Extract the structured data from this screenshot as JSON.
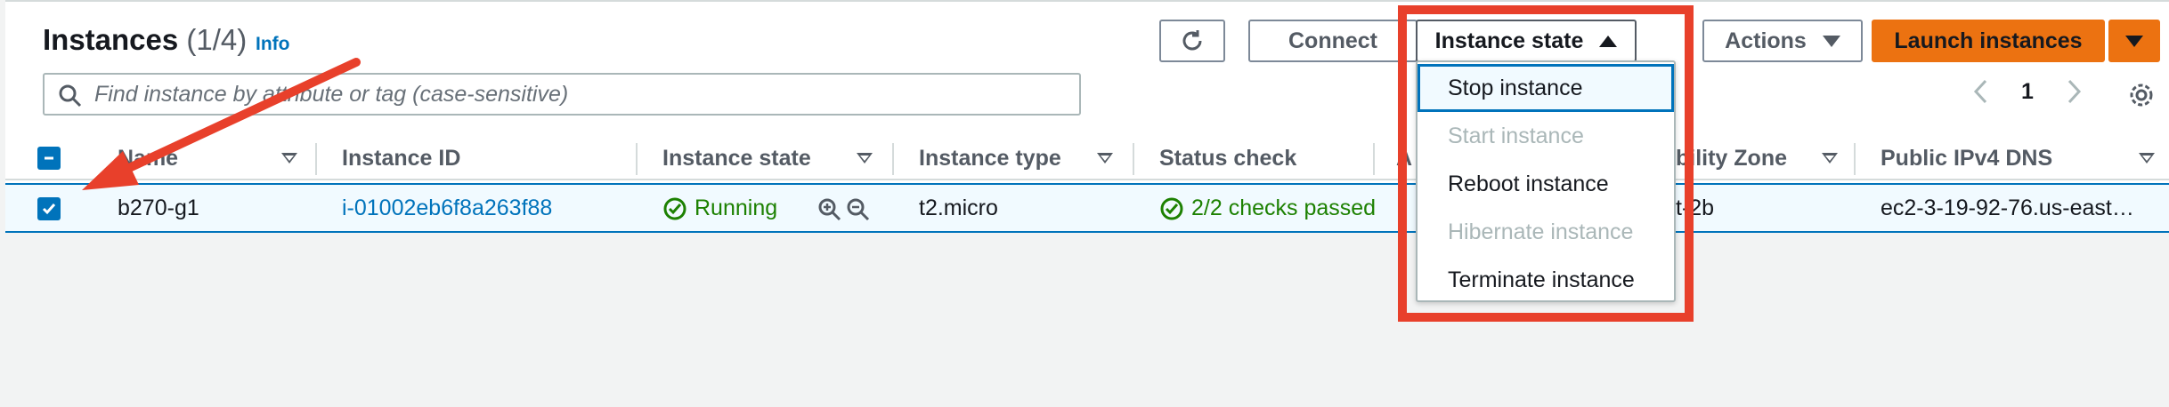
{
  "header": {
    "title": "Instances",
    "count": "(1/4)",
    "info_label": "Info"
  },
  "toolbar": {
    "connect_label": "Connect",
    "instance_state_label": "Instance state",
    "actions_label": "Actions",
    "launch_label": "Launch instances"
  },
  "search": {
    "placeholder": "Find instance by attribute or tag (case-sensitive)"
  },
  "pagination": {
    "page": "1"
  },
  "table": {
    "columns": {
      "name": "Name",
      "instance_id": "Instance ID",
      "instance_state": "Instance state",
      "instance_type": "Instance type",
      "status_check": "Status check",
      "alarm_fragment": "A",
      "availability_zone_fragment": "bility Zone",
      "public_dns": "Public IPv4 DNS"
    },
    "row": {
      "selected": true,
      "name": "b270-g1",
      "instance_id": "i-01002eb6f8a263f88",
      "instance_state": "Running",
      "instance_type": "t2.micro",
      "status_check": "2/2 checks passed",
      "availability_zone_fragment": "t-2b",
      "public_dns": "ec2-3-19-92-76.us-east…"
    }
  },
  "instance_state_menu": {
    "items": [
      {
        "label": "Stop instance",
        "state": "focused"
      },
      {
        "label": "Start instance",
        "state": "disabled"
      },
      {
        "label": "Reboot instance",
        "state": "enabled"
      },
      {
        "label": "Hibernate instance",
        "state": "disabled"
      },
      {
        "label": "Terminate instance",
        "state": "enabled"
      }
    ]
  },
  "colors": {
    "link": "#0073bb",
    "success": "#1d8102",
    "primary_button": "#ec7211",
    "annotation": "#e8402b",
    "disabled_text": "#aab7b8"
  },
  "icons": [
    "refresh-icon",
    "caret-up-icon",
    "caret-down-icon",
    "search-icon",
    "chevron-left-icon",
    "chevron-right-icon",
    "gear-icon",
    "check-circle-icon",
    "zoom-in-icon",
    "zoom-out-icon",
    "checkbox-checked-icon"
  ]
}
